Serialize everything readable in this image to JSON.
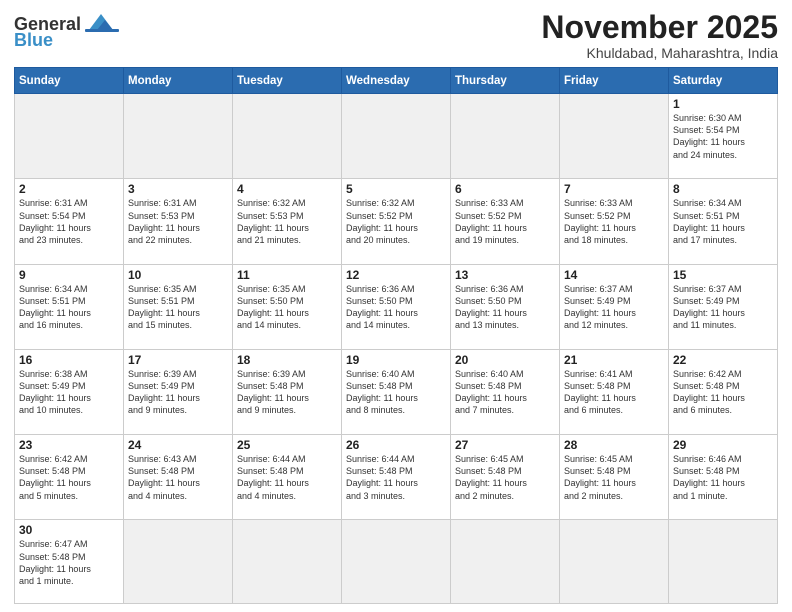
{
  "header": {
    "logo_general": "General",
    "logo_blue": "Blue",
    "month_title": "November 2025",
    "location": "Khuldabad, Maharashtra, India"
  },
  "weekdays": [
    "Sunday",
    "Monday",
    "Tuesday",
    "Wednesday",
    "Thursday",
    "Friday",
    "Saturday"
  ],
  "weeks": [
    [
      {
        "day": "",
        "info": ""
      },
      {
        "day": "",
        "info": ""
      },
      {
        "day": "",
        "info": ""
      },
      {
        "day": "",
        "info": ""
      },
      {
        "day": "",
        "info": ""
      },
      {
        "day": "",
        "info": ""
      },
      {
        "day": "1",
        "info": "Sunrise: 6:30 AM\nSunset: 5:54 PM\nDaylight: 11 hours\nand 24 minutes."
      }
    ],
    [
      {
        "day": "2",
        "info": "Sunrise: 6:31 AM\nSunset: 5:54 PM\nDaylight: 11 hours\nand 23 minutes."
      },
      {
        "day": "3",
        "info": "Sunrise: 6:31 AM\nSunset: 5:53 PM\nDaylight: 11 hours\nand 22 minutes."
      },
      {
        "day": "4",
        "info": "Sunrise: 6:32 AM\nSunset: 5:53 PM\nDaylight: 11 hours\nand 21 minutes."
      },
      {
        "day": "5",
        "info": "Sunrise: 6:32 AM\nSunset: 5:52 PM\nDaylight: 11 hours\nand 20 minutes."
      },
      {
        "day": "6",
        "info": "Sunrise: 6:33 AM\nSunset: 5:52 PM\nDaylight: 11 hours\nand 19 minutes."
      },
      {
        "day": "7",
        "info": "Sunrise: 6:33 AM\nSunset: 5:52 PM\nDaylight: 11 hours\nand 18 minutes."
      },
      {
        "day": "8",
        "info": "Sunrise: 6:34 AM\nSunset: 5:51 PM\nDaylight: 11 hours\nand 17 minutes."
      }
    ],
    [
      {
        "day": "9",
        "info": "Sunrise: 6:34 AM\nSunset: 5:51 PM\nDaylight: 11 hours\nand 16 minutes."
      },
      {
        "day": "10",
        "info": "Sunrise: 6:35 AM\nSunset: 5:51 PM\nDaylight: 11 hours\nand 15 minutes."
      },
      {
        "day": "11",
        "info": "Sunrise: 6:35 AM\nSunset: 5:50 PM\nDaylight: 11 hours\nand 14 minutes."
      },
      {
        "day": "12",
        "info": "Sunrise: 6:36 AM\nSunset: 5:50 PM\nDaylight: 11 hours\nand 14 minutes."
      },
      {
        "day": "13",
        "info": "Sunrise: 6:36 AM\nSunset: 5:50 PM\nDaylight: 11 hours\nand 13 minutes."
      },
      {
        "day": "14",
        "info": "Sunrise: 6:37 AM\nSunset: 5:49 PM\nDaylight: 11 hours\nand 12 minutes."
      },
      {
        "day": "15",
        "info": "Sunrise: 6:37 AM\nSunset: 5:49 PM\nDaylight: 11 hours\nand 11 minutes."
      }
    ],
    [
      {
        "day": "16",
        "info": "Sunrise: 6:38 AM\nSunset: 5:49 PM\nDaylight: 11 hours\nand 10 minutes."
      },
      {
        "day": "17",
        "info": "Sunrise: 6:39 AM\nSunset: 5:49 PM\nDaylight: 11 hours\nand 9 minutes."
      },
      {
        "day": "18",
        "info": "Sunrise: 6:39 AM\nSunset: 5:48 PM\nDaylight: 11 hours\nand 9 minutes."
      },
      {
        "day": "19",
        "info": "Sunrise: 6:40 AM\nSunset: 5:48 PM\nDaylight: 11 hours\nand 8 minutes."
      },
      {
        "day": "20",
        "info": "Sunrise: 6:40 AM\nSunset: 5:48 PM\nDaylight: 11 hours\nand 7 minutes."
      },
      {
        "day": "21",
        "info": "Sunrise: 6:41 AM\nSunset: 5:48 PM\nDaylight: 11 hours\nand 6 minutes."
      },
      {
        "day": "22",
        "info": "Sunrise: 6:42 AM\nSunset: 5:48 PM\nDaylight: 11 hours\nand 6 minutes."
      }
    ],
    [
      {
        "day": "23",
        "info": "Sunrise: 6:42 AM\nSunset: 5:48 PM\nDaylight: 11 hours\nand 5 minutes."
      },
      {
        "day": "24",
        "info": "Sunrise: 6:43 AM\nSunset: 5:48 PM\nDaylight: 11 hours\nand 4 minutes."
      },
      {
        "day": "25",
        "info": "Sunrise: 6:44 AM\nSunset: 5:48 PM\nDaylight: 11 hours\nand 4 minutes."
      },
      {
        "day": "26",
        "info": "Sunrise: 6:44 AM\nSunset: 5:48 PM\nDaylight: 11 hours\nand 3 minutes."
      },
      {
        "day": "27",
        "info": "Sunrise: 6:45 AM\nSunset: 5:48 PM\nDaylight: 11 hours\nand 2 minutes."
      },
      {
        "day": "28",
        "info": "Sunrise: 6:45 AM\nSunset: 5:48 PM\nDaylight: 11 hours\nand 2 minutes."
      },
      {
        "day": "29",
        "info": "Sunrise: 6:46 AM\nSunset: 5:48 PM\nDaylight: 11 hours\nand 1 minute."
      }
    ],
    [
      {
        "day": "30",
        "info": "Sunrise: 6:47 AM\nSunset: 5:48 PM\nDaylight: 11 hours\nand 1 minute."
      },
      {
        "day": "",
        "info": ""
      },
      {
        "day": "",
        "info": ""
      },
      {
        "day": "",
        "info": ""
      },
      {
        "day": "",
        "info": ""
      },
      {
        "day": "",
        "info": ""
      },
      {
        "day": "",
        "info": ""
      }
    ]
  ]
}
